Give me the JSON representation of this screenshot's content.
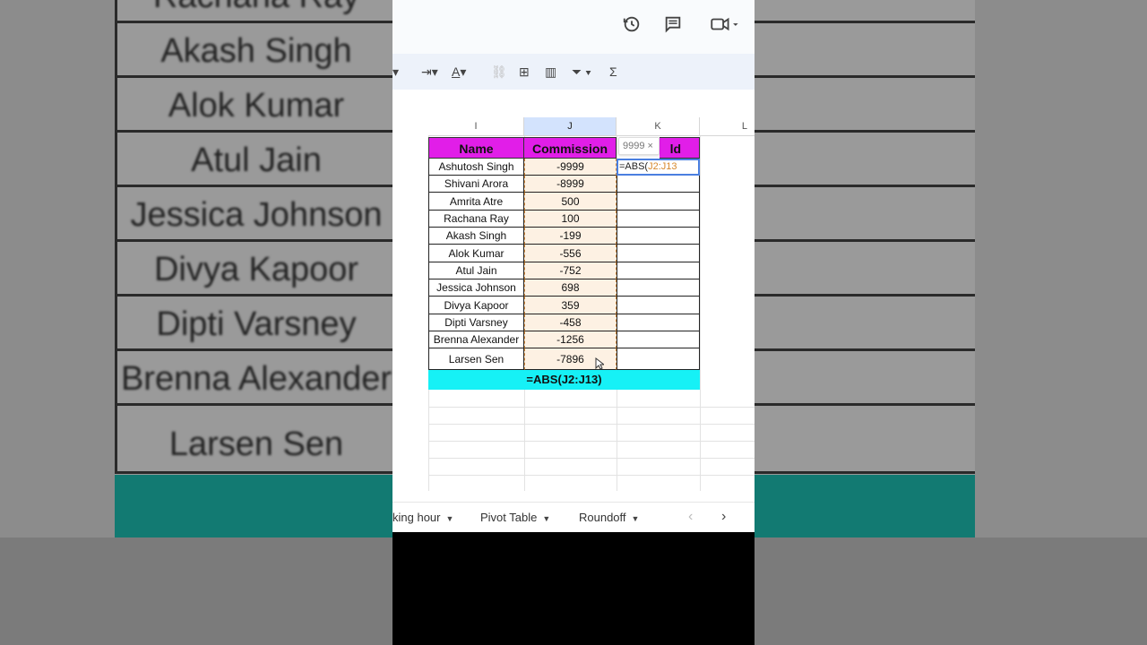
{
  "background": {
    "rows": [
      "Rachana Ray",
      "Akash Singh",
      "Alok Kumar",
      "Atul Jain",
      "Jessica Johnson",
      "Divya Kapoor",
      "Dipti Varsney",
      "Brenna Alexander",
      "Larsen Sen"
    ]
  },
  "topbar": {
    "icons": [
      "history-icon",
      "comment-icon",
      "meet-icon"
    ]
  },
  "toolbar": {
    "sigma": "Σ"
  },
  "columns": {
    "i": "I",
    "j": "J",
    "k": "K",
    "l": "L"
  },
  "table": {
    "headers": {
      "name": "Name",
      "commission": "Commission",
      "k_tail": "ld"
    },
    "rows": [
      {
        "name": "Ashutosh Singh",
        "commission": "-9999"
      },
      {
        "name": "Shivani Arora",
        "commission": "-8999"
      },
      {
        "name": "Amrita Atre",
        "commission": "500"
      },
      {
        "name": "Rachana Ray",
        "commission": "100"
      },
      {
        "name": "Akash Singh",
        "commission": "-199"
      },
      {
        "name": "Alok Kumar",
        "commission": "-556"
      },
      {
        "name": "Atul Jain",
        "commission": "-752"
      },
      {
        "name": "Jessica Johnson",
        "commission": "698"
      },
      {
        "name": "Divya Kapoor",
        "commission": "359"
      },
      {
        "name": "Dipti Varsney",
        "commission": "-458"
      },
      {
        "name": "Brenna Alexander",
        "commission": "-1256"
      },
      {
        "name": "Larsen Sen",
        "commission": "-7896"
      }
    ],
    "footer": "=ABS(J2:J13)"
  },
  "editor": {
    "prefix": "=ABS(",
    "ref": "J2:J13",
    "hint": "9999 ×"
  },
  "tabs": {
    "t1": "king hour",
    "t2": "Pivot Table",
    "t3": "Roundoff"
  },
  "colors": {
    "header": "#e11ee8",
    "footer": "#16f1f6",
    "selection": "#4a7fe0"
  }
}
